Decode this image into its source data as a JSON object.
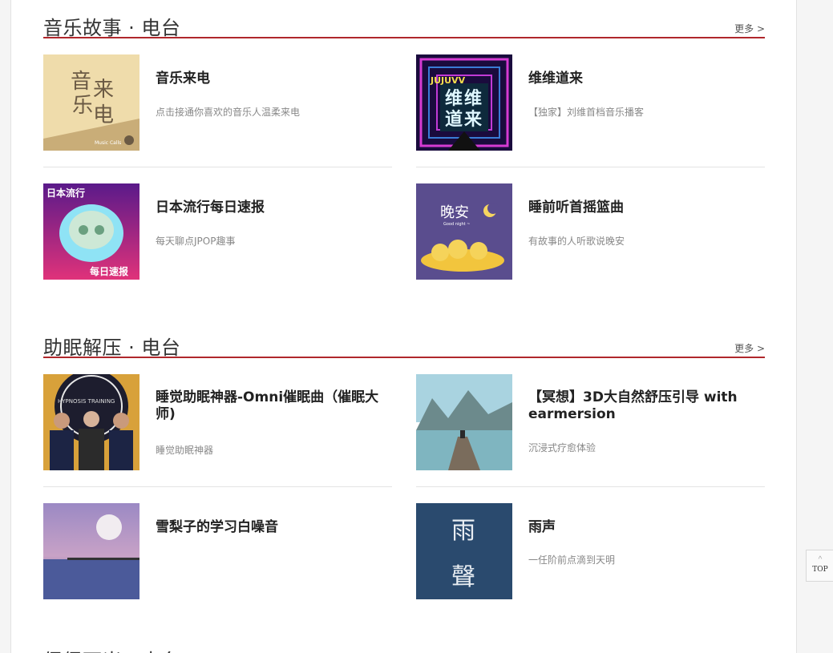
{
  "sections": [
    {
      "title": "音乐故事 · 电台",
      "more": "更多 >",
      "items": [
        {
          "title": "音乐来电",
          "desc": "点击接通你喜欢的音乐人温柔来电",
          "thumb_text": [
            "音",
            "来",
            "乐",
            "电"
          ],
          "thumb_caption": "Music Calls"
        },
        {
          "title": "维维道来",
          "desc": "【独家】刘维首档音乐播客",
          "thumb_text": [
            "维",
            "维",
            "道",
            "来"
          ],
          "thumb_caption": "JUJUVV"
        },
        {
          "title": "日本流行每日速报",
          "desc": "每天聊点JPOP趣事",
          "thumb_text": [
            "日本流行",
            "每日速报"
          ]
        },
        {
          "title": "睡前听首摇篮曲",
          "desc": "有故事的人听歌说晚安",
          "thumb_text": [
            "晚安"
          ],
          "thumb_caption": "Good night ~"
        }
      ]
    },
    {
      "title": "助眠解压 · 电台",
      "more": "更多 >",
      "items": [
        {
          "title": "睡觉助眠神器-Omni催眠曲（催眠大师)",
          "desc": "睡觉助眠神器",
          "thumb_caption": "HYPNOSIS TRAINING"
        },
        {
          "title": "【冥想】3D大自然舒压引导 with earmersion",
          "desc": "沉浸式疗愈体验"
        },
        {
          "title": "雪梨子的学习白噪音",
          "desc": ""
        },
        {
          "title": "雨声",
          "desc": "一任阶前点滴到天明",
          "thumb_text": [
            "雨",
            "聲"
          ]
        }
      ]
    },
    {
      "title": "促促下米 · 电台"
    }
  ],
  "top_button": {
    "arrow": "^",
    "label": "TOP"
  }
}
